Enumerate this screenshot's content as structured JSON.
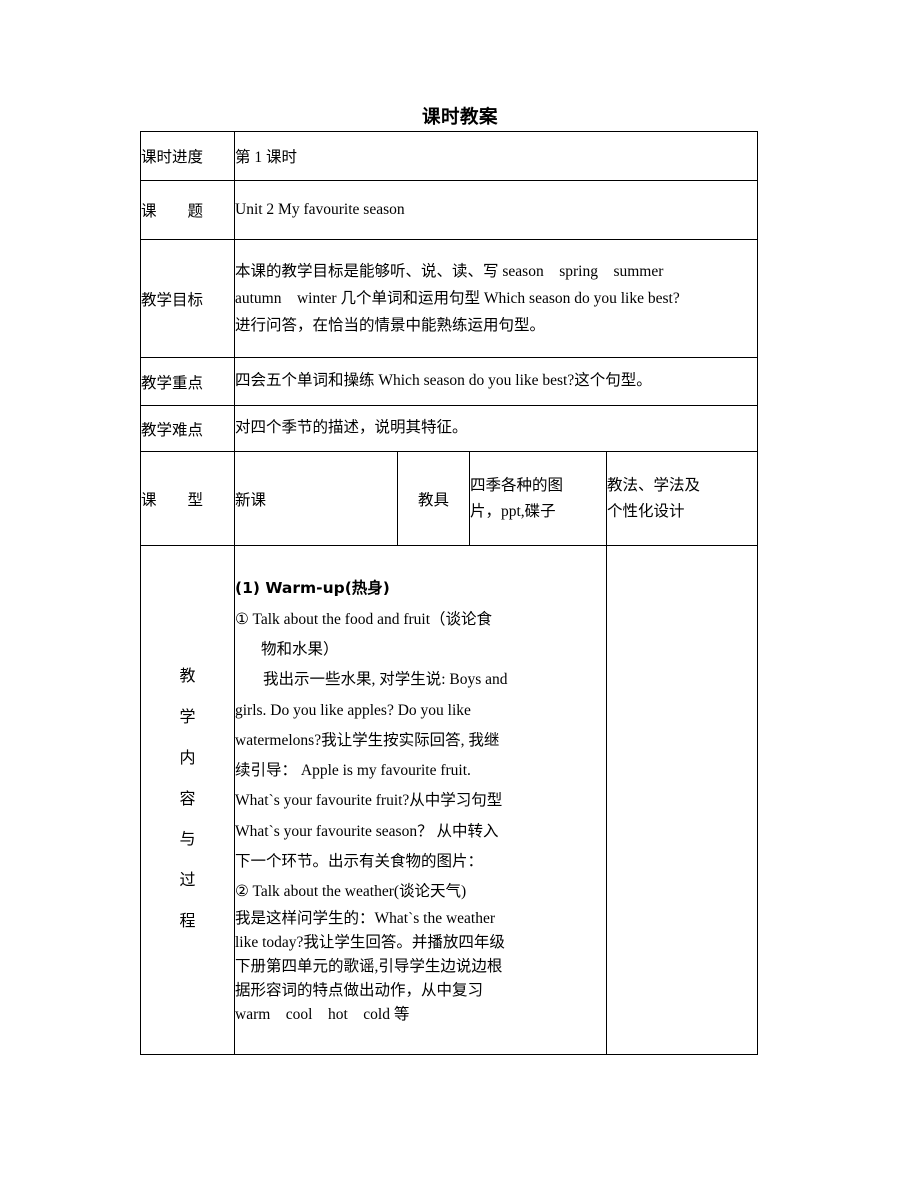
{
  "document": {
    "title": "课时教案"
  },
  "table": {
    "rows": {
      "progress": {
        "label": "课时进度",
        "value": "第 1 课时"
      },
      "topic": {
        "label_chars": [
          "课",
          "题"
        ],
        "label": "课　　题",
        "value": "Unit 2 My favourite season"
      },
      "goals": {
        "label": "教学目标",
        "line1": "本课的教学目标是能够听、说、读、写 season　spring　summer",
        "line2": "autumn　winter 几个单词和运用句型 Which season do you like best?",
        "line3": "进行问答，在恰当的情景中能熟练运用句型。"
      },
      "key_points": {
        "label": "教学重点",
        "value": "四会五个单词和操练 Which season do you like best?这个句型。"
      },
      "difficult_points": {
        "label": "教学难点",
        "value": "对四个季节的描述，说明其特征。"
      },
      "lesson_type": {
        "label": "课　　型",
        "value": "新课",
        "aids_label": "教具",
        "aids_value_line1": "四季各种的图",
        "aids_value_line2": "片，ppt,碟子",
        "design_label_line1": "教法、学法及",
        "design_label_line2": "个性化设计"
      },
      "content": {
        "label_chars": [
          "教",
          "学",
          "内",
          "容",
          "与",
          "过",
          "程"
        ],
        "paragraphs": [
          {
            "id": "p1",
            "style": "bold",
            "text": "(1) Warm-up(热身)"
          },
          {
            "id": "p2",
            "style": "item",
            "text": "①  Talk about the food and fruit（谈论食"
          },
          {
            "id": "p3",
            "style": "indent1",
            "text": "物和水果）"
          },
          {
            "id": "p4",
            "style": "indent-first",
            "text": "我出示一些水果, 对学生说: Boys and"
          },
          {
            "id": "p5",
            "style": "plain",
            "text": "girls. Do you like apples? Do you like"
          },
          {
            "id": "p6",
            "style": "plain",
            "text": "watermelons?我让学生按实际回答, 我继"
          },
          {
            "id": "p7",
            "style": "plain",
            "text": "续引导： Apple is my favourite fruit."
          },
          {
            "id": "p8",
            "style": "plain",
            "text": "What`s your favourite fruit?从中学习句型"
          },
          {
            "id": "p9",
            "style": "plain",
            "text": "What`s your favourite season？ 从中转入"
          },
          {
            "id": "p10",
            "style": "plain",
            "text": "下一个环节。出示有关食物的图片："
          },
          {
            "id": "p11",
            "style": "item",
            "text": "②  Talk about the weather(谈论天气)"
          },
          {
            "id": "p12",
            "style": "tightj",
            "text": "我是这样问学生的：What`s the weather"
          },
          {
            "id": "p13",
            "style": "tight",
            "text": "like today?我让学生回答。并播放四年级"
          },
          {
            "id": "p14",
            "style": "tight",
            "text": "下册第四单元的歌谣,引导学生边说边根"
          },
          {
            "id": "p15",
            "style": "tight",
            "text": "据形容词的特点做出动作，从中复习"
          },
          {
            "id": "p16",
            "style": "tight",
            "text": "warm　cool　hot　cold 等"
          }
        ]
      }
    }
  }
}
